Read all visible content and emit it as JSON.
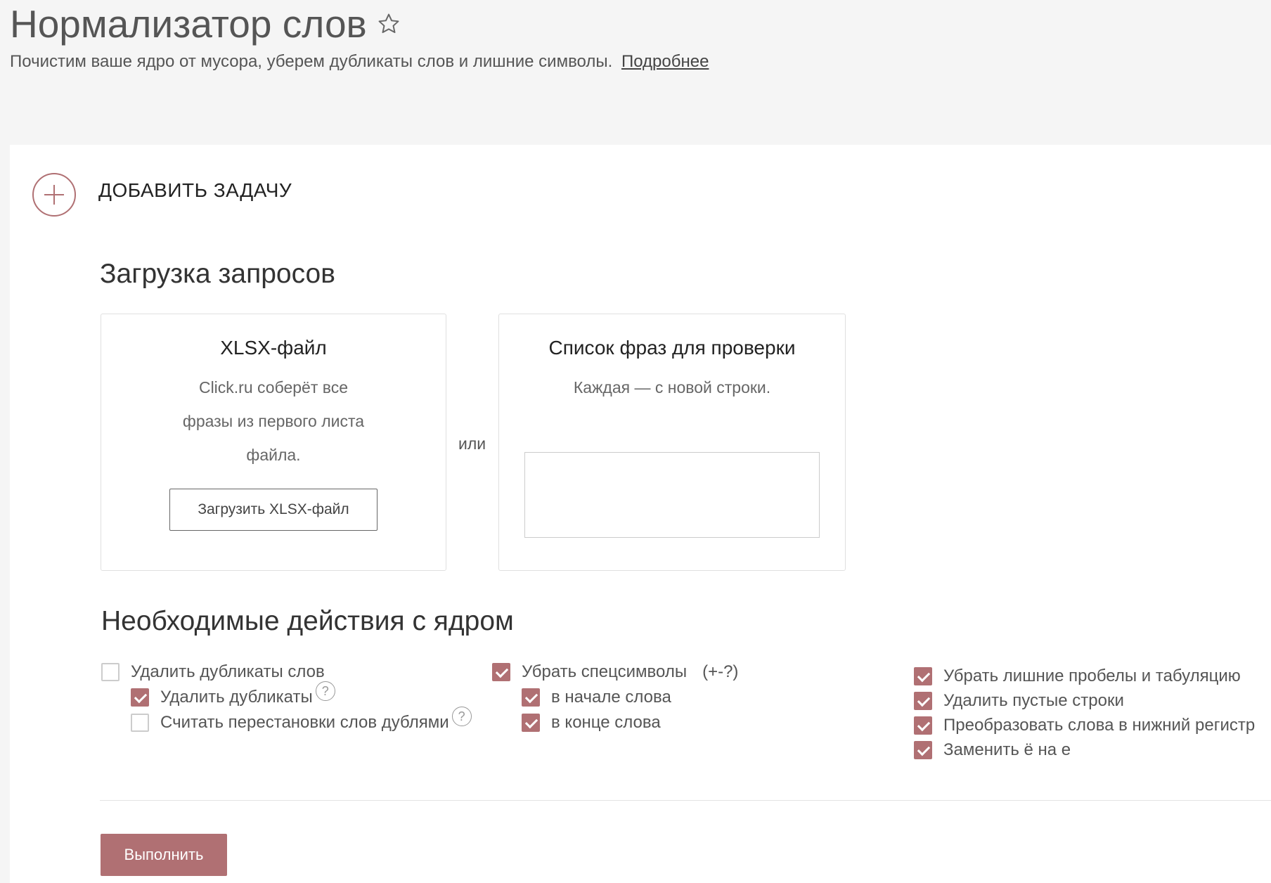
{
  "header": {
    "title": "Нормализатор слов",
    "subtitle": "Почистим ваше ядро от мусора, уберем дубликаты слов и лишние символы.",
    "more_link": "Подробнее"
  },
  "add_task": {
    "label": "ДОБАВИТЬ ЗАДАЧУ"
  },
  "upload": {
    "section_title": "Загрузка запросов",
    "xlsx": {
      "title": "XLSX-файл",
      "description": "Click.ru соберёт все фразы из первого листа файла.",
      "button_label": "Загрузить XLSX-файл"
    },
    "or_label": "или",
    "list": {
      "title": "Список фраз для проверки",
      "description": "Каждая — с новой строки.",
      "input_value": ""
    }
  },
  "actions": {
    "section_title": "Необходимые действия с ядром",
    "col1": {
      "main": {
        "label": "Удалить дубликаты слов",
        "checked": false
      },
      "remove_duplicates": {
        "label": "Удалить дубликаты",
        "checked": true
      },
      "permutations": {
        "label": "Считать перестановки слов дублями",
        "checked": false
      }
    },
    "col2": {
      "main": {
        "label": "Убрать спецсимволы",
        "hint": "(+-?)",
        "checked": true
      },
      "word_start": {
        "label": "в начале слова",
        "checked": true
      },
      "word_end": {
        "label": "в конце слова",
        "checked": true
      }
    },
    "col3": {
      "spaces": {
        "label": "Убрать лишние пробелы и табуляцию",
        "checked": true
      },
      "empty_lines": {
        "label": "Удалить пустые строки",
        "checked": true
      },
      "lowercase": {
        "label": "Преобразовать слова в нижний регистр",
        "checked": true
      },
      "yo_to_e": {
        "label": "Заменить ё на е",
        "checked": true
      }
    },
    "help_glyph": "?"
  },
  "run_button": {
    "label": "Выполнить"
  },
  "colors": {
    "accent": "#b07073",
    "background": "#f5f5f5"
  },
  "icons": {
    "favorite": "star-icon",
    "add": "plus-circle-icon",
    "help": "question-icon"
  }
}
